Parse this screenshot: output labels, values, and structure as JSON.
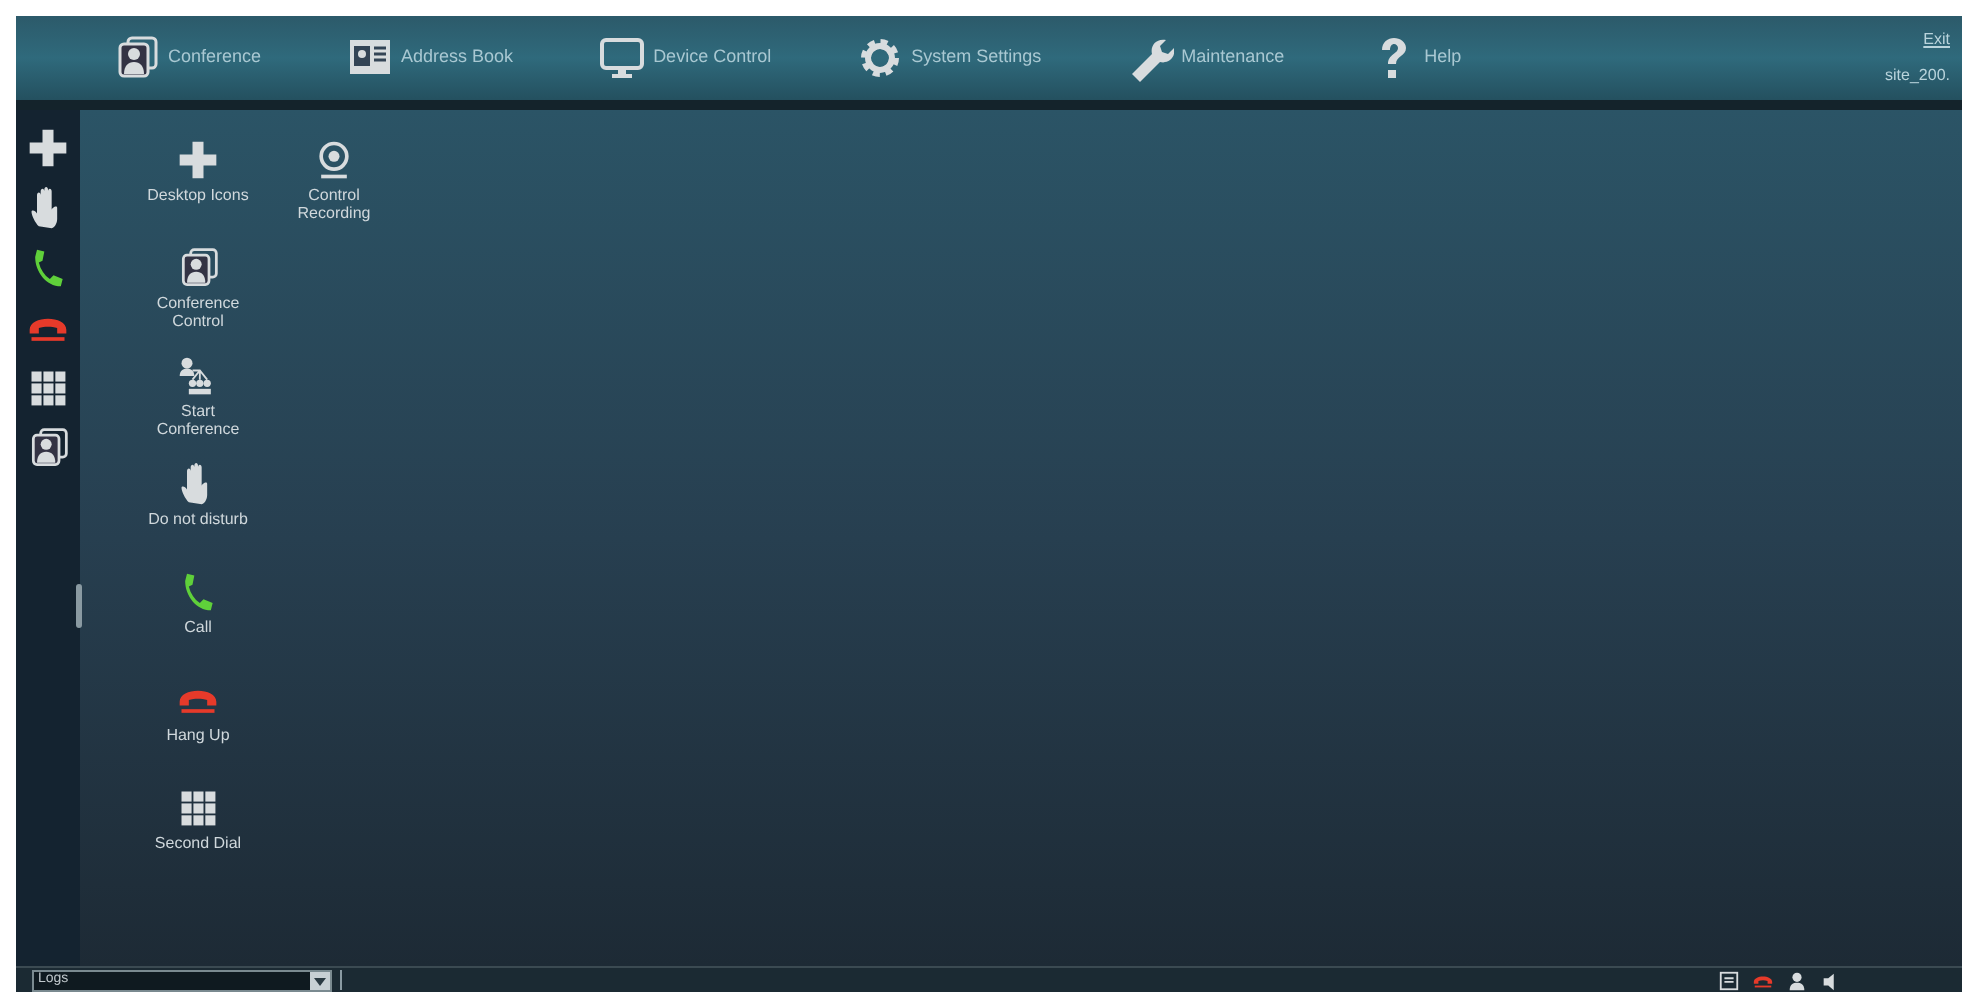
{
  "nav": [
    {
      "label": "Conference",
      "kind": "conference"
    },
    {
      "label": "Address Book",
      "kind": "addressbook"
    },
    {
      "label": "Device Control",
      "kind": "monitor"
    },
    {
      "label": "System Settings",
      "kind": "gear"
    },
    {
      "label": "Maintenance",
      "kind": "wrench"
    },
    {
      "label": "Help",
      "kind": "help"
    }
  ],
  "account": {
    "exit": "Exit",
    "site": "site_200."
  },
  "sidebar": [
    {
      "kind": "plus"
    },
    {
      "kind": "hand"
    },
    {
      "kind": "call"
    },
    {
      "kind": "hangup"
    },
    {
      "kind": "keypad"
    },
    {
      "kind": "conference"
    }
  ],
  "desktop_columns": [
    [
      {
        "label": "Desktop Icons",
        "kind": "plus"
      },
      {
        "label": "Conference Control",
        "kind": "conference"
      },
      {
        "label": "Start Conference",
        "kind": "people"
      },
      {
        "label": "Do not disturb",
        "kind": "hand"
      },
      {
        "label": "Call",
        "kind": "call"
      },
      {
        "label": "Hang Up",
        "kind": "hangup"
      },
      {
        "label": "Second Dial",
        "kind": "keypad"
      }
    ],
    [
      {
        "label": "Control Recording",
        "kind": "webcam"
      }
    ]
  ],
  "status_bar": {
    "dropdown": {
      "value": "Logs"
    },
    "tray": [
      {
        "kind": "box"
      },
      {
        "kind": "hangup"
      },
      {
        "kind": "person"
      },
      {
        "kind": "speaker"
      }
    ]
  }
}
